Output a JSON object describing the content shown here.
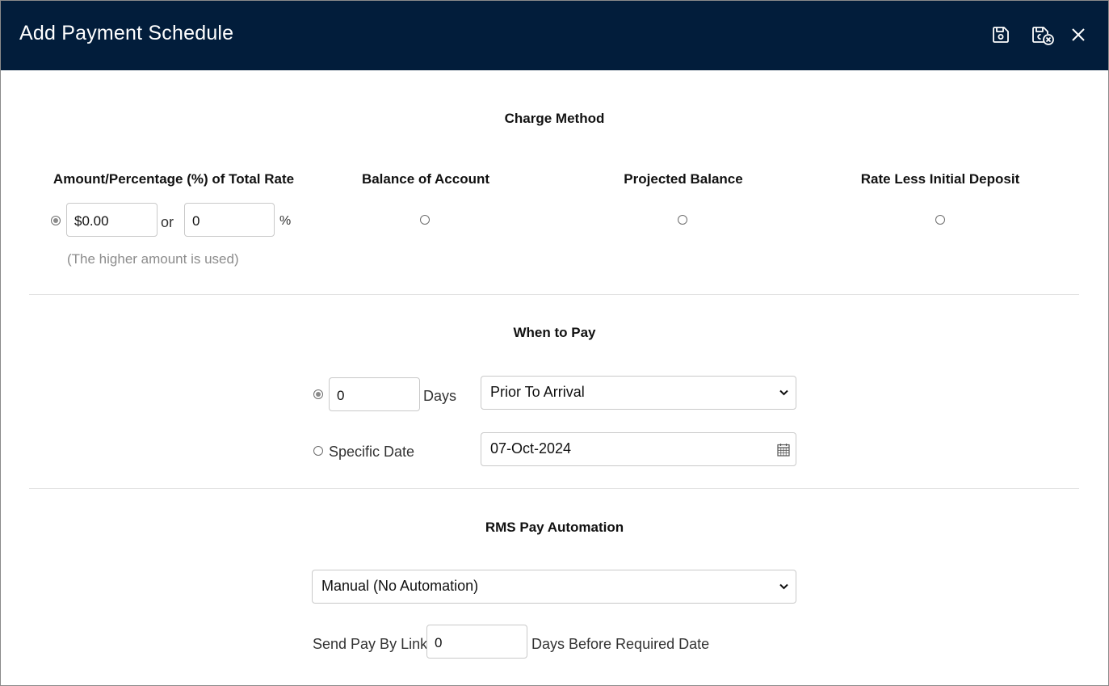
{
  "dialog": {
    "title": "Add Payment Schedule",
    "header_color": "#021d3b",
    "icons": {
      "save": "save-icon",
      "save_close": "save-close-icon",
      "close": "close-icon"
    }
  },
  "charge_method": {
    "title": "Charge Method",
    "options": [
      {
        "label": "Amount/Percentage (%) of Total Rate",
        "selected": true
      },
      {
        "label": "Balance of Account",
        "selected": false
      },
      {
        "label": "Projected Balance",
        "selected": false
      },
      {
        "label": "Rate Less Initial Deposit",
        "selected": false
      }
    ],
    "amount_value": "$0.00",
    "or_label": "or",
    "percent_value": "0",
    "percent_symbol": "%",
    "hint": "(The higher amount is used)"
  },
  "when_to_pay": {
    "title": "When to Pay",
    "days_value": "0",
    "days_label": "Days",
    "timing_select": "Prior To Arrival",
    "specific_date_label": "Specific Date",
    "date_value": "07-Oct-2024",
    "days_selected": true
  },
  "automation": {
    "title": "RMS Pay Automation",
    "select_value": "Manual (No Automation)",
    "send_label": "Send Pay By Link",
    "send_days_value": "0",
    "send_suffix": "Days Before Required Date"
  }
}
